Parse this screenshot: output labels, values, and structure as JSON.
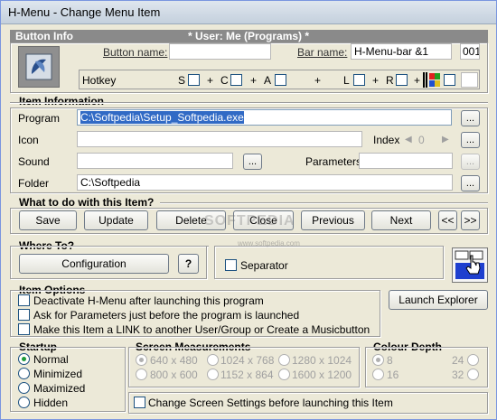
{
  "window": {
    "title": "H-Menu - Change Menu Item"
  },
  "button_info": {
    "header": "Button Info",
    "user_header": "* User: Me (Programs) *",
    "button_name_label": "Button name:",
    "button_name_value": "",
    "bar_name_label": "Bar name:",
    "bar_name_value": "H-Menu-bar &1",
    "bar_number": "001",
    "hotkey_label": "Hotkey",
    "mod_s": "S",
    "mod_c": "C",
    "mod_a": "A",
    "mod_l": "L",
    "mod_r": "R",
    "plus": "+"
  },
  "item_information": {
    "header": "Item Information",
    "program_label": "Program",
    "program_value": "C:\\Softpedia\\Setup_Softpedia.exe",
    "icon_label": "Icon",
    "icon_value": "",
    "index_label": "Index",
    "index_value": "0",
    "sound_label": "Sound",
    "sound_value": "",
    "parameters_label": "Parameters",
    "parameters_value": "",
    "folder_label": "Folder",
    "folder_value": "C:\\Softpedia",
    "browse_label": "..."
  },
  "actions": {
    "header": "What to do with this Item?",
    "save": "Save",
    "update": "Update",
    "delete": "Delete",
    "close": "Close",
    "previous": "Previous",
    "next": "Next",
    "first": "<<",
    "last": ">>"
  },
  "where_to": {
    "header": "Where To?",
    "configuration": "Configuration",
    "help": "?",
    "separator": "Separator"
  },
  "item_options": {
    "header": "Item Options",
    "opt1": "Deactivate H-Menu after launching this program",
    "opt2": "Ask for Parameters just before the program is launched",
    "opt3": "Make this Item a LINK to another User/Group or Create a Musicbutton",
    "launch_explorer": "Launch Explorer"
  },
  "startup": {
    "header": "Startup",
    "options": [
      "Normal",
      "Minimized",
      "Maximized",
      "Hidden"
    ],
    "selected": "Normal"
  },
  "screen": {
    "header": "Screen Measurements",
    "options": [
      "640 x 480",
      "1024 x 768",
      "1280 x 1024",
      "800 x 600",
      "1152 x 864",
      "1600 x 1200"
    ],
    "change_settings": "Change Screen Settings before launching this Item"
  },
  "colour": {
    "header": "Colour Depth",
    "options": [
      "8",
      "24",
      "16",
      "32"
    ]
  },
  "watermark": {
    "text": "SOFTPEDIA",
    "url": "www.softpedia.com"
  }
}
